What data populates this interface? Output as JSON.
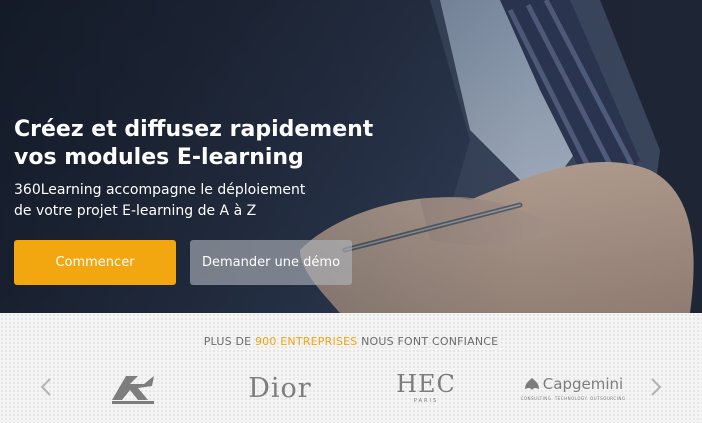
{
  "hero": {
    "headline_line1": "Créez et diffusez rapidement",
    "headline_line2": "vos modules E-learning",
    "subline_line1": "360Learning accompagne le déploiement",
    "subline_line2": "de votre projet E-learning de A à Z",
    "primary_button": "Commencer",
    "secondary_button": "Demander une démo"
  },
  "trust": {
    "prefix": "PLUS DE ",
    "highlight": "900 ENTREPRISES",
    "suffix": " NOUS FONT CONFIANCE",
    "prev_icon": "chevron-left-icon",
    "next_icon": "chevron-right-icon",
    "logos": {
      "dior": "Dior",
      "hec_main": "HEC",
      "hec_sub": "PARIS",
      "capgemini_main": "Capgemini",
      "capgemini_sub": "CONSULTING. TECHNOLOGY. OUTSOURCING"
    }
  },
  "colors": {
    "accent": "#f2a60f",
    "secondary_button": "#b0b4bc",
    "logo_gray": "#7d7d7d"
  }
}
